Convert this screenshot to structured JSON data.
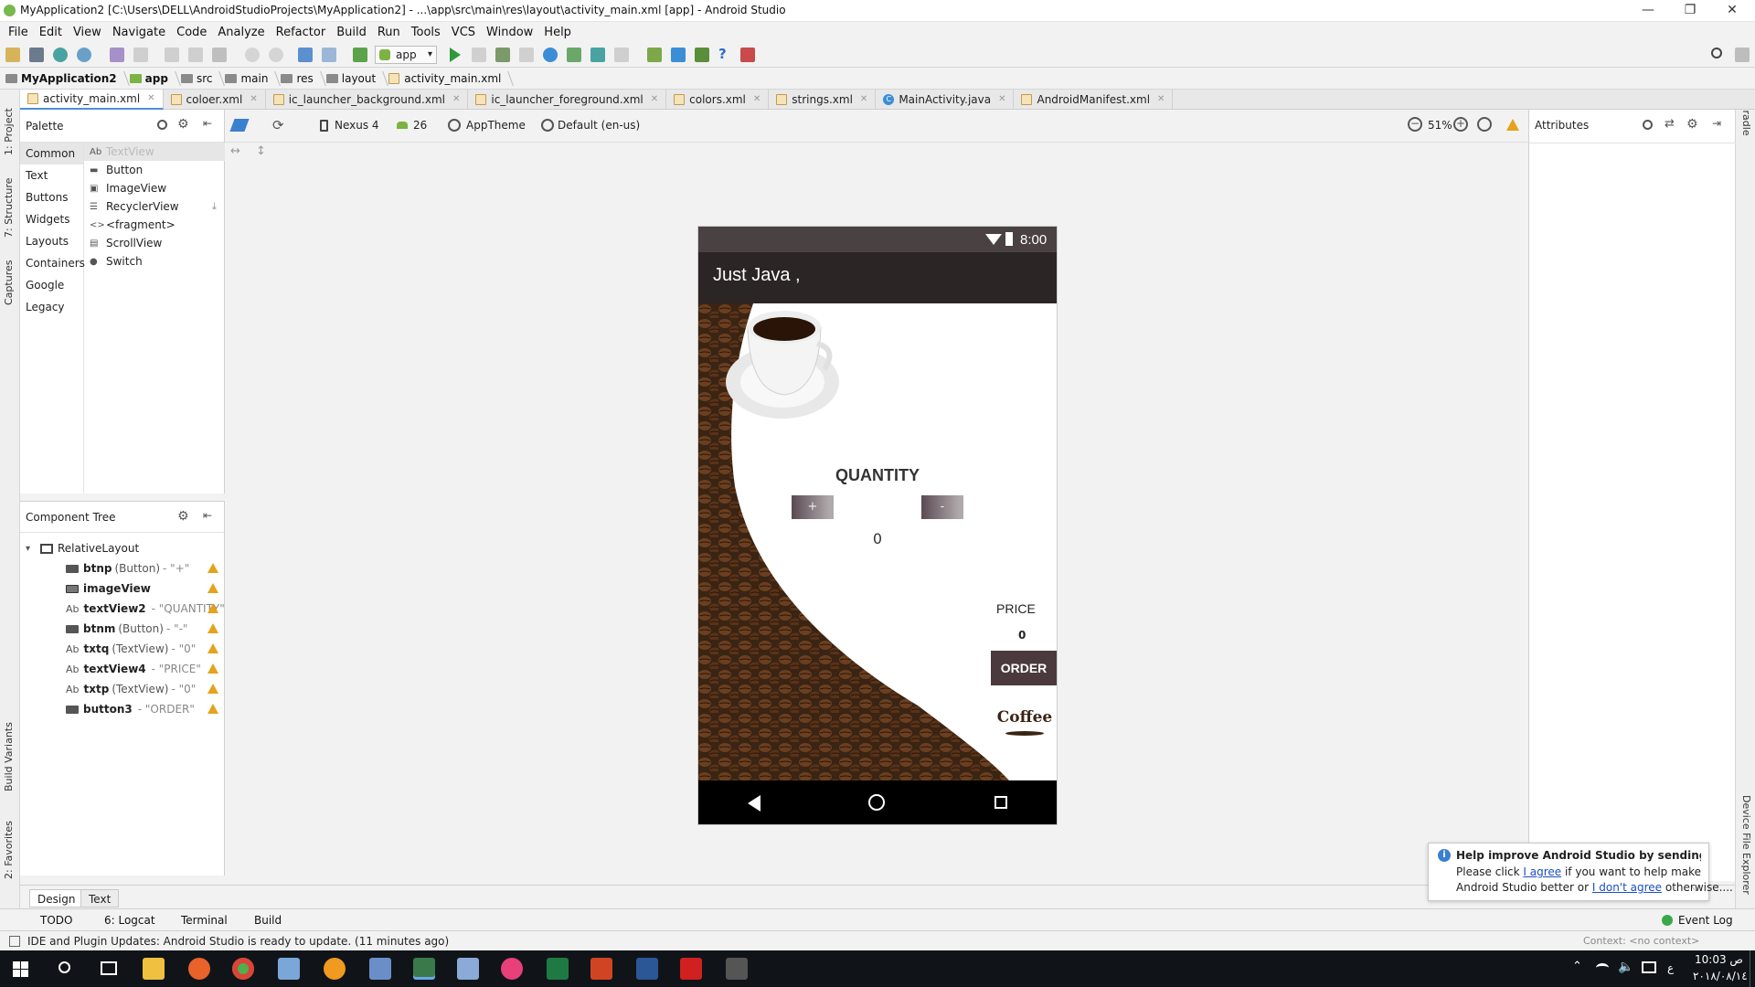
{
  "window": {
    "title": "MyApplication2 [C:\\Users\\DELL\\AndroidStudioProjects\\MyApplication2] - ...\\app\\src\\main\\res\\layout\\activity_main.xml [app] - Android Studio"
  },
  "menu": [
    "File",
    "Edit",
    "View",
    "Navigate",
    "Code",
    "Analyze",
    "Refactor",
    "Build",
    "Run",
    "Tools",
    "VCS",
    "Window",
    "Help"
  ],
  "toolbar": {
    "run_config": "app"
  },
  "breadcrumb": [
    "MyApplication2",
    "app",
    "src",
    "main",
    "res",
    "layout",
    "activity_main.xml"
  ],
  "editor_tabs": [
    {
      "label": "activity_main.xml",
      "active": true,
      "kind": "xml"
    },
    {
      "label": "coloer.xml",
      "kind": "xml"
    },
    {
      "label": "ic_launcher_background.xml",
      "kind": "xml"
    },
    {
      "label": "ic_launcher_foreground.xml",
      "kind": "xml"
    },
    {
      "label": "colors.xml",
      "kind": "xml"
    },
    {
      "label": "strings.xml",
      "kind": "xml"
    },
    {
      "label": "MainActivity.java",
      "kind": "java"
    },
    {
      "label": "AndroidManifest.xml",
      "kind": "manifest"
    }
  ],
  "left_strip": [
    "1: Project",
    "7: Structure",
    "Captures",
    "Build Variants",
    "2: Favorites"
  ],
  "right_strip": [
    "Gradle",
    "Device File Explorer"
  ],
  "palette": {
    "title": "Palette",
    "categories": [
      "Common",
      "Text",
      "Buttons",
      "Widgets",
      "Layouts",
      "Containers",
      "Google",
      "Legacy"
    ],
    "items": [
      {
        "icon": "Ab",
        "label": "TextView"
      },
      {
        "icon": "▬",
        "label": "Button"
      },
      {
        "icon": "▣",
        "label": "ImageView"
      },
      {
        "icon": "☰",
        "label": "RecyclerView"
      },
      {
        "icon": "<>",
        "label": "<fragment>"
      },
      {
        "icon": "▤",
        "label": "ScrollView"
      },
      {
        "icon": "●",
        "label": "Switch"
      }
    ]
  },
  "component_tree": {
    "title": "Component Tree",
    "root": "RelativeLayout",
    "items": [
      {
        "icon": "btn",
        "name": "btnp",
        "type": "(Button)",
        "value": "- \"+\""
      },
      {
        "icon": "img",
        "name": "imageView",
        "type": "",
        "value": ""
      },
      {
        "icon": "Ab",
        "name": "textView2",
        "type": "",
        "value": "- \"QUANTITY\""
      },
      {
        "icon": "btn",
        "name": "btnm",
        "type": "(Button)",
        "value": "- \"-\""
      },
      {
        "icon": "Ab",
        "name": "txtq",
        "type": "(TextView)",
        "value": "- \"0\""
      },
      {
        "icon": "Ab",
        "name": "textView4",
        "type": "",
        "value": "- \"PRICE\""
      },
      {
        "icon": "Ab",
        "name": "txtp",
        "type": "(TextView)",
        "value": "- \"0\""
      },
      {
        "icon": "btn",
        "name": "button3",
        "type": "",
        "value": "- \"ORDER\""
      }
    ]
  },
  "design_toolbar": {
    "device": "Nexus 4",
    "api": "26",
    "theme": "AppTheme",
    "locale": "Default (en-us)",
    "zoom": "51%"
  },
  "attributes": {
    "title": "Attributes"
  },
  "phone": {
    "time": "8:00",
    "app_title": "Just Java ,",
    "quantity_label": "QUANTITY",
    "plus": "+",
    "minus": "-",
    "quantity_value": "0",
    "price_label": "PRICE",
    "price_value": "0",
    "order": "ORDER",
    "logo_text": "Coffee"
  },
  "design_tabs": [
    "Design",
    "Text"
  ],
  "tool_windows": {
    "todo": "TODO",
    "logcat": "6: Logcat",
    "terminal": "Terminal",
    "build": "Build",
    "event_log": "Event Log"
  },
  "status": {
    "message": "IDE and Plugin Updates: Android Studio is ready to update. (11 minutes ago)",
    "context": "Context: <no context>"
  },
  "notification": {
    "title": "Help improve Android Studio by sending usage s",
    "line1_pre": "Please click ",
    "agree": "I agree",
    "line1_post": " if you want to help make",
    "line2_pre": "Android Studio better or ",
    "disagree": "I don't agree",
    "line2_post": " otherwise...."
  },
  "clock": {
    "time": "10:03 ص",
    "date": "٢٠١٨/٠٨/١٤",
    "lang": "ع"
  }
}
